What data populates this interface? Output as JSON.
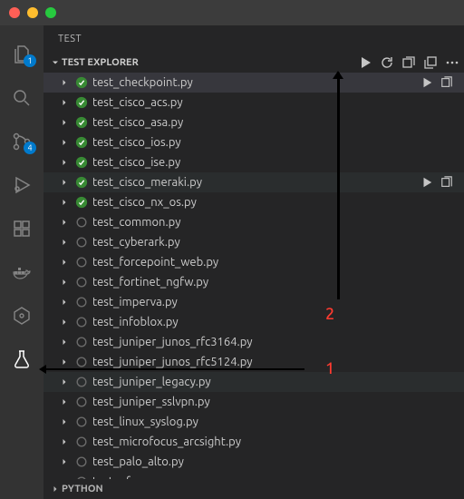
{
  "window": {
    "panel_title": "TEST"
  },
  "activitybar": {
    "explorer_badge": "1",
    "scm_badge": "4"
  },
  "section": {
    "title": "TEST EXPLORER",
    "next_title": "PYTHON"
  },
  "tests": [
    {
      "name": "test_checkpoint.py",
      "status": "pass",
      "selected": true,
      "actions": true
    },
    {
      "name": "test_cisco_acs.py",
      "status": "pass"
    },
    {
      "name": "test_cisco_asa.py",
      "status": "pass"
    },
    {
      "name": "test_cisco_ios.py",
      "status": "pass"
    },
    {
      "name": "test_cisco_ise.py",
      "status": "pass"
    },
    {
      "name": "test_cisco_meraki.py",
      "status": "pass",
      "hl": true,
      "actions": true
    },
    {
      "name": "test_cisco_nx_os.py",
      "status": "pass"
    },
    {
      "name": "test_common.py",
      "status": "notrun"
    },
    {
      "name": "test_cyberark.py",
      "status": "notrun"
    },
    {
      "name": "test_forcepoint_web.py",
      "status": "notrun"
    },
    {
      "name": "test_fortinet_ngfw.py",
      "status": "notrun"
    },
    {
      "name": "test_imperva.py",
      "status": "notrun"
    },
    {
      "name": "test_infoblox.py",
      "status": "notrun"
    },
    {
      "name": "test_juniper_junos_rfc3164.py",
      "status": "notrun"
    },
    {
      "name": "test_juniper_junos_rfc5124.py",
      "status": "notrun"
    },
    {
      "name": "test_juniper_legacy.py",
      "status": "notrun",
      "hl": true
    },
    {
      "name": "test_juniper_sslvpn.py",
      "status": "notrun"
    },
    {
      "name": "test_linux_syslog.py",
      "status": "notrun"
    },
    {
      "name": "test_microfocus_arcsight.py",
      "status": "notrun"
    },
    {
      "name": "test_palo_alto.py",
      "status": "notrun"
    },
    {
      "name": "test_pfsense.py",
      "status": "notrun"
    }
  ],
  "annotations": {
    "label1": "1",
    "label2": "2"
  }
}
